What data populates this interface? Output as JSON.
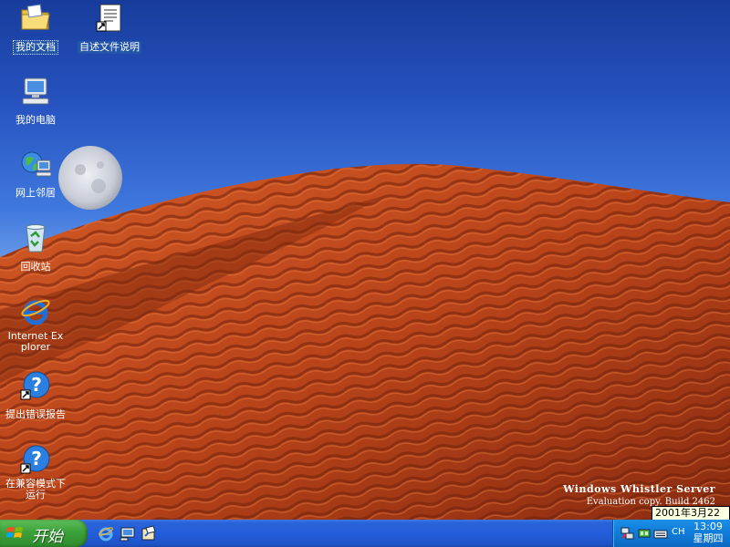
{
  "desktop": {
    "icons": [
      {
        "label": "我的文档"
      },
      {
        "label": "自述文件说明"
      },
      {
        "label": "我的电脑"
      },
      {
        "label": "网上邻居"
      },
      {
        "label": "回收站"
      },
      {
        "label": "Internet Explorer"
      },
      {
        "label": "提出错误报告"
      },
      {
        "label": "在兼容模式下运行"
      }
    ],
    "watermark": {
      "line1": "Windows Whistler Server",
      "line2": "Evaluation copy. Build 2462"
    },
    "date_tooltip": "2001年3月22日"
  },
  "taskbar": {
    "start_label": "开始",
    "quick_launch": [
      {
        "icon": "internet-explorer-icon"
      },
      {
        "icon": "show-desktop-icon"
      },
      {
        "icon": "media-player-icon"
      }
    ],
    "tray": {
      "language": "CH",
      "time": "13:09",
      "weekday": "星期四"
    }
  },
  "colors": {
    "taskbar_blue": "#245ddb",
    "start_green": "#3ca13a",
    "tray_blue": "#0f7bd8",
    "selection_blue": "#2355a8",
    "sand": "#b84820"
  }
}
